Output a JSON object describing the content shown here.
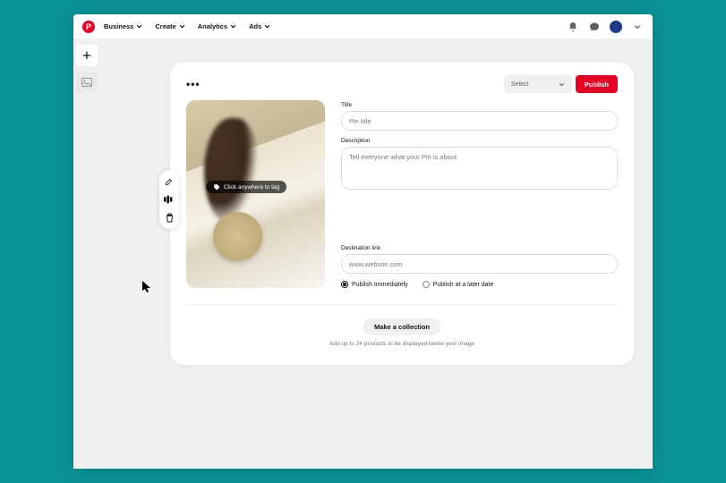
{
  "topbar": {
    "nav": {
      "business": "Business",
      "create": "Create",
      "analytics": "Analytics",
      "ads": "Ads"
    }
  },
  "card": {
    "select_label": "Select",
    "publish_label": "Publish",
    "tag_overlay": "Click anywhere to tag",
    "title_label": "Title",
    "title_placeholder": "Pin title",
    "desc_label": "Description",
    "desc_placeholder": "Tell everyone what your Pin is about",
    "link_label": "Destination link",
    "link_placeholder": "www.website.com",
    "radio_now": "Publish Immediately",
    "radio_later": "Publish at a later date",
    "make_collection": "Make a collection",
    "collection_help": "Add up to 24 products to be displayed below your image"
  }
}
